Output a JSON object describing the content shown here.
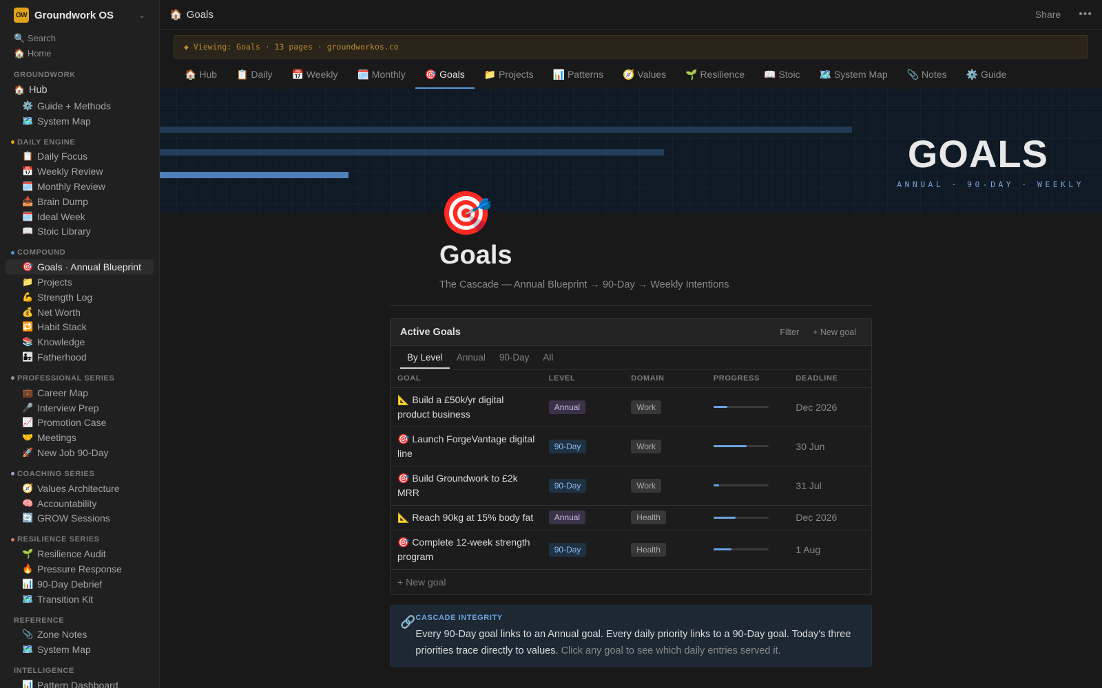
{
  "workspace": {
    "logo": "GW",
    "name": "Groundwork OS",
    "chevron": "⌄"
  },
  "sidebar": {
    "quick": [
      {
        "icon": "🔍",
        "label": "Search"
      },
      {
        "icon": "🏠",
        "label": "Home"
      }
    ],
    "sections": [
      {
        "title": "GROUNDWORK",
        "dot": "",
        "items": [
          {
            "icon": "🏠",
            "label": "Hub",
            "top": true
          },
          {
            "icon": "⚙️",
            "label": "Guide + Methods"
          },
          {
            "icon": "🗺️",
            "label": "System Map"
          }
        ]
      },
      {
        "title": "DAILY ENGINE",
        "dot": "#e0a21c",
        "items": [
          {
            "icon": "📋",
            "label": "Daily Focus"
          },
          {
            "icon": "📅",
            "label": "Weekly Review"
          },
          {
            "icon": "🗓️",
            "label": "Monthly Review"
          },
          {
            "icon": "📥",
            "label": "Brain Dump"
          },
          {
            "icon": "🗓️",
            "label": "Ideal Week"
          },
          {
            "icon": "📖",
            "label": "Stoic Library"
          }
        ]
      },
      {
        "title": "COMPOUND",
        "dot": "#5a93d6",
        "items": [
          {
            "icon": "🎯",
            "label": "Goals · Annual Blueprint",
            "active": true
          },
          {
            "icon": "📁",
            "label": "Projects"
          },
          {
            "icon": "💪",
            "label": "Strength Log"
          },
          {
            "icon": "💰",
            "label": "Net Worth"
          },
          {
            "icon": "🔁",
            "label": "Habit Stack"
          },
          {
            "icon": "📚",
            "label": "Knowledge"
          },
          {
            "icon": "👨‍👧",
            "label": "Fatherhood"
          }
        ]
      },
      {
        "title": "PROFESSIONAL SERIES",
        "dot": "#9a9a9a",
        "items": [
          {
            "icon": "💼",
            "label": "Career Map"
          },
          {
            "icon": "🎤",
            "label": "Interview Prep"
          },
          {
            "icon": "📈",
            "label": "Promotion Case"
          },
          {
            "icon": "🤝",
            "label": "Meetings"
          },
          {
            "icon": "🚀",
            "label": "New Job 90-Day"
          }
        ]
      },
      {
        "title": "COACHING SERIES",
        "dot": "#a99be0",
        "items": [
          {
            "icon": "🧭",
            "label": "Values Architecture"
          },
          {
            "icon": "🧠",
            "label": "Accountability"
          },
          {
            "icon": "🔄",
            "label": "GROW Sessions"
          }
        ]
      },
      {
        "title": "RESILIENCE SERIES",
        "dot": "#e07a6a",
        "items": [
          {
            "icon": "🌱",
            "label": "Resilience Audit"
          },
          {
            "icon": "🔥",
            "label": "Pressure Response"
          },
          {
            "icon": "📊",
            "label": "90-Day Debrief"
          },
          {
            "icon": "🗺️",
            "label": "Transition Kit"
          }
        ]
      },
      {
        "title": "REFERENCE",
        "dot": "",
        "items": [
          {
            "icon": "📎",
            "label": "Zone Notes"
          },
          {
            "icon": "🗺️",
            "label": "System Map"
          }
        ]
      },
      {
        "title": "INTELLIGENCE",
        "dot": "",
        "items": [
          {
            "icon": "📊",
            "label": "Pattern Dashboard"
          }
        ]
      }
    ]
  },
  "topbar": {
    "icon": "🏠",
    "title": "Goals",
    "share": "Share",
    "more": "•••"
  },
  "banner": {
    "text": "◆ Viewing: Goals · 13 pages · groundworkos.co"
  },
  "tabs": [
    {
      "icon": "🏠",
      "label": "Hub"
    },
    {
      "icon": "📋",
      "label": "Daily"
    },
    {
      "icon": "📅",
      "label": "Weekly"
    },
    {
      "icon": "🗓️",
      "label": "Monthly"
    },
    {
      "icon": "🎯",
      "label": "Goals",
      "active": true
    },
    {
      "icon": "📁",
      "label": "Projects"
    },
    {
      "icon": "📊",
      "label": "Patterns"
    },
    {
      "icon": "🧭",
      "label": "Values"
    },
    {
      "icon": "🌱",
      "label": "Resilience"
    },
    {
      "icon": "📖",
      "label": "Stoic"
    },
    {
      "icon": "🗺️",
      "label": "System Map"
    },
    {
      "icon": "📎",
      "label": "Notes"
    },
    {
      "icon": "⚙️",
      "label": "Guide"
    }
  ],
  "hero": {
    "title": "GOALS",
    "subtitle": "ANNUAL · 90-DAY · WEEKLY",
    "bars": [
      {
        "fraction": 0.735,
        "color": "#223a55"
      },
      {
        "fraction": 0.535,
        "color": "#243e5c"
      },
      {
        "fraction": 0.2,
        "color": "#4f7fb8"
      }
    ]
  },
  "page": {
    "emoji": "🎯",
    "title": "Goals",
    "subtitle": "The Cascade — Annual Blueprint → 90-Day → Weekly Intentions"
  },
  "goals_db": {
    "title": "Active Goals",
    "filter_label": "Filter",
    "new_label": "+ New goal",
    "views": [
      {
        "label": "By Level",
        "active": true
      },
      {
        "label": "Annual"
      },
      {
        "label": "90-Day"
      },
      {
        "label": "All"
      }
    ],
    "columns": [
      "GOAL",
      "LEVEL",
      "DOMAIN",
      "PROGRESS",
      "DEADLINE"
    ],
    "rows": [
      {
        "icon": "📐",
        "goal": "Build a £50k/yr digital product business",
        "level": "Annual",
        "domain": "Work",
        "progress": 0.25,
        "deadline": "Dec 2026",
        "tall": true
      },
      {
        "icon": "🎯",
        "goal": "Launch ForgeVantage digital line",
        "level": "90-Day",
        "domain": "Work",
        "progress": 0.6,
        "deadline": "30 Jun",
        "tall": true
      },
      {
        "icon": "🎯",
        "goal": "Build Groundwork to £2k MRR",
        "level": "90-Day",
        "domain": "Work",
        "progress": 0.1,
        "deadline": "31 Jul",
        "tall": true
      },
      {
        "icon": "📐",
        "goal": "Reach 90kg at 15% body fat",
        "level": "Annual",
        "domain": "Health",
        "progress": 0.4,
        "deadline": "Dec 2026",
        "tall": false
      },
      {
        "icon": "🎯",
        "goal": "Complete 12-week strength program",
        "level": "90-Day",
        "domain": "Health",
        "progress": 0.33,
        "deadline": "1 Aug",
        "tall": true
      }
    ],
    "new_row": "+ New goal"
  },
  "callout": {
    "icon": "🔗",
    "title": "CASCADE INTEGRITY",
    "body": "Every 90-Day goal links to an Annual goal. Every daily priority links to a 90-Day goal. Today's three priorities trace directly to values.",
    "muted": "Click any goal to see which daily entries served it."
  }
}
